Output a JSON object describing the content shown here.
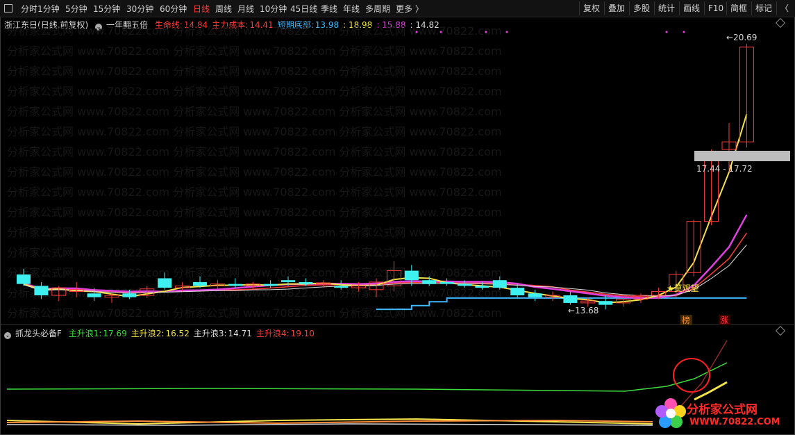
{
  "toolbar": {
    "periods": [
      "分时",
      "1分钟",
      "5分钟",
      "15分钟",
      "30分钟",
      "60分钟",
      "日线",
      "周线",
      "月线",
      "10分钟",
      "45日线",
      "季线",
      "年线",
      "多周期",
      "更多 〉"
    ],
    "active_period": "日线",
    "tools": [
      "复权",
      "叠加",
      "多股",
      "统计",
      "画线",
      "F10",
      "简框",
      "标记"
    ],
    "close_label": "〈"
  },
  "main_panel": {
    "stock": "浙江东日",
    "mode": "(日线,前复权)",
    "indicator": "一年翻五倍",
    "legend": [
      {
        "label": "生命线:",
        "value": "14.84",
        "color": "#ff3b3b"
      },
      {
        "label": "主力成本:",
        "value": "14.41",
        "color": "#ff3b3b"
      },
      {
        "label": "短期底部:",
        "value": "13.98",
        "color": "#3fb8ff"
      },
      {
        "label": "",
        "value": ": 18.98",
        "color": "#f5e34a"
      },
      {
        "label": "",
        "value": ": 15.88",
        "color": "#e040e0"
      },
      {
        "label": "",
        "value": ": 14.82",
        "color": "#dddddd"
      }
    ],
    "annotations": {
      "high": "20.69",
      "low": "←13.68",
      "range": "17.44 - 17.72",
      "star": "★莫观望",
      "tag1": "榜",
      "tag2": "涨"
    }
  },
  "sub_panel": {
    "indicator": "抓龙头必备F",
    "legend": [
      {
        "label": "主升浪1:",
        "value": "17.69",
        "color": "#3ddc3d"
      },
      {
        "label": "主升浪2:",
        "value": "16.52",
        "color": "#f5e34a"
      },
      {
        "label": "主升浪3:",
        "value": "14.71",
        "color": "#dddddd"
      },
      {
        "label": "主升浪4:",
        "value": "19.10",
        "color": "#ff3b3b"
      }
    ]
  },
  "logo": {
    "name": "分析家公式网",
    "url": "WWW.70822.COM"
  },
  "chart_data": {
    "type": "candlestick",
    "candles": [
      {
        "o": 14.6,
        "h": 14.75,
        "l": 14.3,
        "c": 14.35
      },
      {
        "o": 14.3,
        "h": 14.4,
        "l": 13.95,
        "c": 14.05
      },
      {
        "o": 14.05,
        "h": 14.3,
        "l": 13.9,
        "c": 14.25
      },
      {
        "o": 14.15,
        "h": 14.4,
        "l": 14.0,
        "c": 14.2
      },
      {
        "o": 14.1,
        "h": 14.25,
        "l": 13.9,
        "c": 14.0
      },
      {
        "o": 14.0,
        "h": 14.1,
        "l": 13.85,
        "c": 14.05
      },
      {
        "o": 14.1,
        "h": 14.2,
        "l": 13.95,
        "c": 14.0
      },
      {
        "o": 14.05,
        "h": 14.3,
        "l": 13.98,
        "c": 14.22
      },
      {
        "o": 14.5,
        "h": 14.65,
        "l": 14.2,
        "c": 14.25
      },
      {
        "o": 14.25,
        "h": 14.4,
        "l": 14.15,
        "c": 14.3
      },
      {
        "o": 14.4,
        "h": 14.55,
        "l": 14.25,
        "c": 14.3
      },
      {
        "o": 14.3,
        "h": 14.45,
        "l": 14.2,
        "c": 14.35
      },
      {
        "o": 14.35,
        "h": 14.5,
        "l": 14.25,
        "c": 14.3
      },
      {
        "o": 14.3,
        "h": 14.4,
        "l": 14.2,
        "c": 14.35
      },
      {
        "o": 14.35,
        "h": 14.45,
        "l": 14.25,
        "c": 14.3
      },
      {
        "o": 14.45,
        "h": 14.55,
        "l": 14.3,
        "c": 14.4
      },
      {
        "o": 14.4,
        "h": 14.5,
        "l": 14.3,
        "c": 14.35
      },
      {
        "o": 14.35,
        "h": 14.45,
        "l": 14.25,
        "c": 14.38
      },
      {
        "o": 14.3,
        "h": 14.45,
        "l": 14.2,
        "c": 14.25
      },
      {
        "o": 14.25,
        "h": 14.4,
        "l": 14.15,
        "c": 14.3
      },
      {
        "o": 14.2,
        "h": 14.5,
        "l": 14.0,
        "c": 14.4
      },
      {
        "o": 14.3,
        "h": 14.95,
        "l": 14.15,
        "c": 14.7
      },
      {
        "o": 14.7,
        "h": 14.85,
        "l": 14.3,
        "c": 14.45
      },
      {
        "o": 14.45,
        "h": 14.55,
        "l": 14.3,
        "c": 14.35
      },
      {
        "o": 14.4,
        "h": 14.5,
        "l": 14.3,
        "c": 14.35
      },
      {
        "o": 14.35,
        "h": 14.45,
        "l": 14.25,
        "c": 14.3
      },
      {
        "o": 14.3,
        "h": 14.4,
        "l": 14.2,
        "c": 14.25
      },
      {
        "o": 14.45,
        "h": 14.55,
        "l": 14.2,
        "c": 14.25
      },
      {
        "o": 14.25,
        "h": 14.35,
        "l": 14.0,
        "c": 14.05
      },
      {
        "o": 14.1,
        "h": 14.2,
        "l": 13.9,
        "c": 14.0
      },
      {
        "o": 14.0,
        "h": 14.15,
        "l": 13.9,
        "c": 14.05
      },
      {
        "o": 14.05,
        "h": 14.15,
        "l": 13.8,
        "c": 13.85
      },
      {
        "o": 13.85,
        "h": 14.0,
        "l": 13.75,
        "c": 13.9
      },
      {
        "o": 13.9,
        "h": 14.05,
        "l": 13.68,
        "c": 13.8
      },
      {
        "o": 13.85,
        "h": 14.0,
        "l": 13.75,
        "c": 13.95
      },
      {
        "o": 13.95,
        "h": 14.1,
        "l": 13.85,
        "c": 14.05
      },
      {
        "o": 14.05,
        "h": 14.25,
        "l": 13.95,
        "c": 14.15
      },
      {
        "o": 14.15,
        "h": 14.7,
        "l": 14.0,
        "c": 14.6
      },
      {
        "o": 14.65,
        "h": 16.05,
        "l": 14.55,
        "c": 16.0
      },
      {
        "o": 16.0,
        "h": 17.9,
        "l": 15.9,
        "c": 17.8
      },
      {
        "o": 17.9,
        "h": 18.6,
        "l": 17.3,
        "c": 18.1
      },
      {
        "o": 18.1,
        "h": 20.69,
        "l": 17.95,
        "c": 20.6
      }
    ],
    "lines": [
      {
        "name": "生命线",
        "color": "#ff3b3b"
      },
      {
        "name": "主力成本",
        "color": "#ff3b3b"
      },
      {
        "name": "短期底部",
        "color": "#3fb8ff"
      }
    ],
    "ylim": [
      13.5,
      21.0
    ]
  }
}
